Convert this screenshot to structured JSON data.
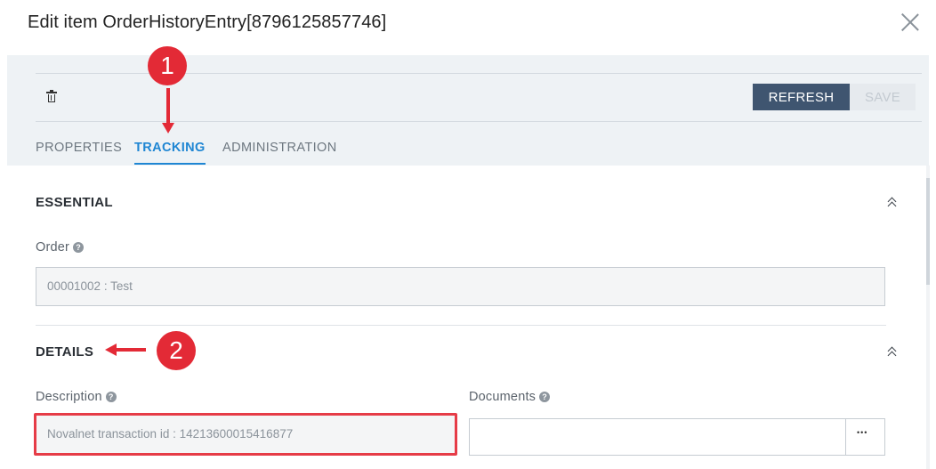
{
  "dialog": {
    "title": "Edit item OrderHistoryEntry[8796125857746]",
    "close_icon": "close-icon"
  },
  "toolbar": {
    "delete_icon": "trash-icon",
    "refresh_label": "REFRESH",
    "save_label": "SAVE"
  },
  "tabs": [
    {
      "label": "PROPERTIES",
      "active": false
    },
    {
      "label": "TRACKING",
      "active": true
    },
    {
      "label": "ADMINISTRATION",
      "active": false
    }
  ],
  "sections": {
    "essential": {
      "title": "ESSENTIAL",
      "order_label": "Order",
      "order_value": "00001002 : Test"
    },
    "details": {
      "title": "DETAILS",
      "description_label": "Description",
      "description_value": "Novalnet transaction id : 14213600015416877",
      "documents_label": "Documents",
      "documents_value": ""
    }
  },
  "annotations": {
    "badge_1": "1",
    "badge_2": "2"
  },
  "colors": {
    "accent": "#1f86d3",
    "refresh_button": "#3f5570",
    "annotation_red": "#e32a36"
  }
}
